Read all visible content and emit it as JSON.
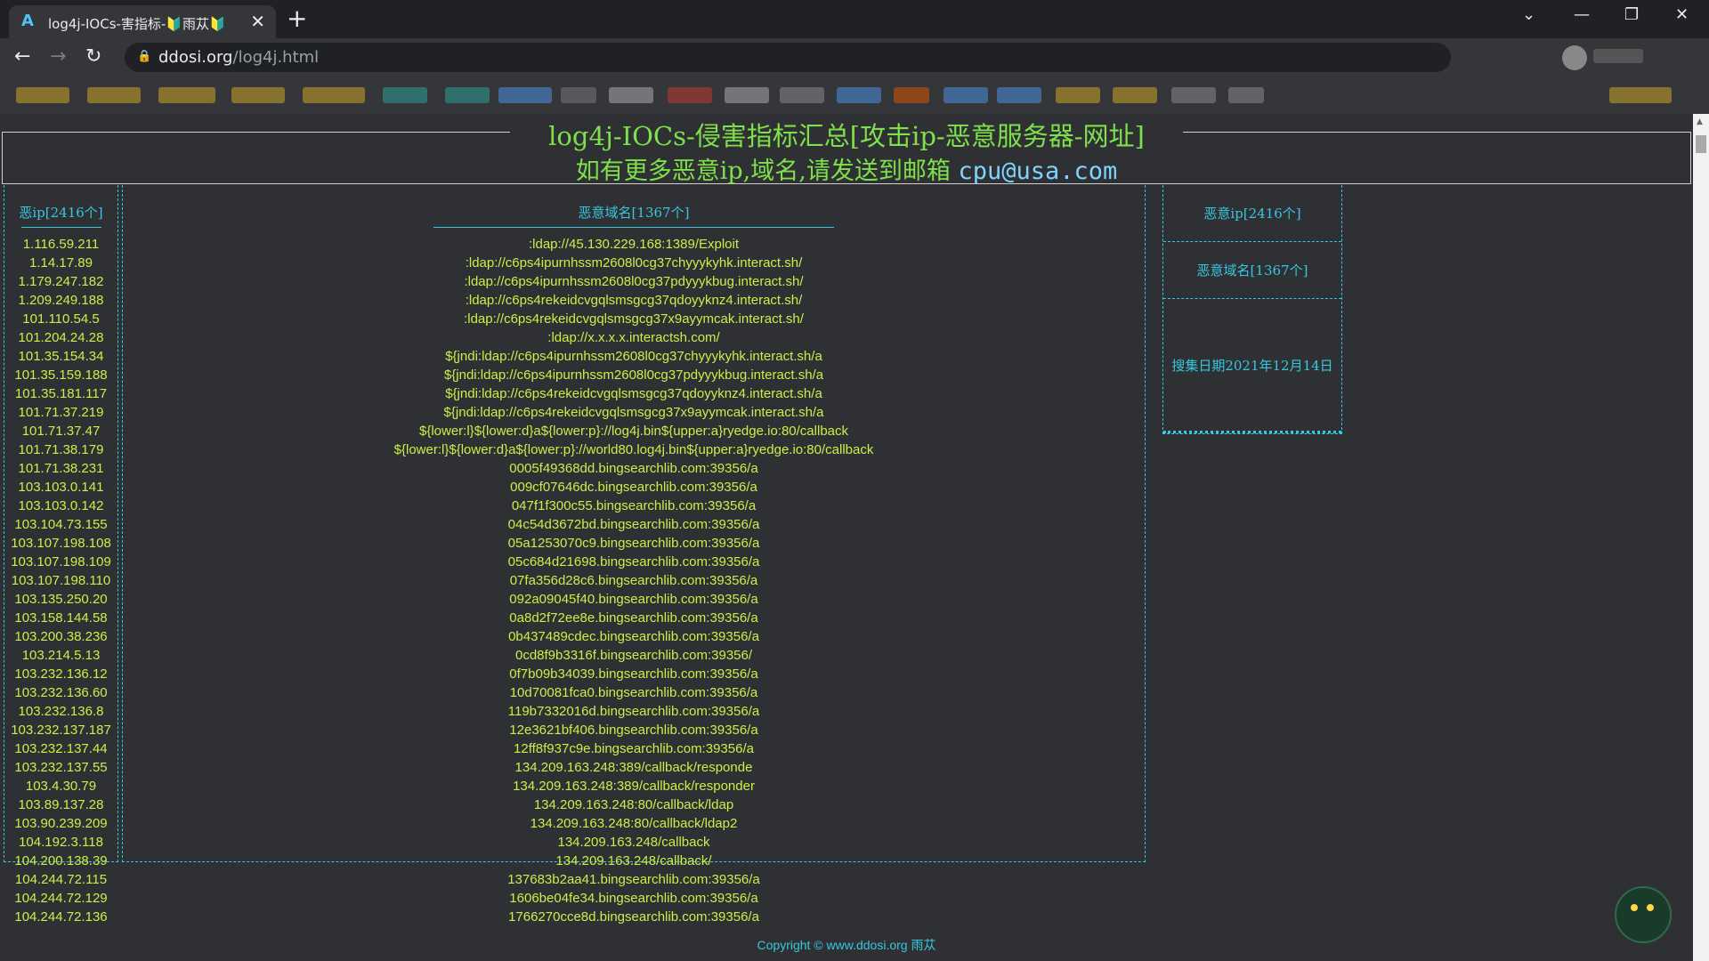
{
  "browser": {
    "tab_title": "log4j-IOCs-害指标-🔰雨苁🔰",
    "url_host": "ddosi.org",
    "url_path": "/log4j.html"
  },
  "header": {
    "title": "log4j-IOCs-侵害指标汇总[攻击ip-恶意服务器-网址]",
    "subtitle": "如有更多恶意ip,域名,请发送到邮箱",
    "email": "cpu@usa.com"
  },
  "left": {
    "title": "恶ip[2416个]",
    "ips": [
      "1.116.59.211",
      "1.14.17.89",
      "1.179.247.182",
      "1.209.249.188",
      "101.110.54.5",
      "101.204.24.28",
      "101.35.154.34",
      "101.35.159.188",
      "101.35.181.117",
      "101.71.37.219",
      "101.71.37.47",
      "101.71.38.179",
      "101.71.38.231",
      "103.103.0.141",
      "103.103.0.142",
      "103.104.73.155",
      "103.107.198.108",
      "103.107.198.109",
      "103.107.198.110",
      "103.135.250.20",
      "103.158.144.58",
      "103.200.38.236",
      "103.214.5.13",
      "103.232.136.12",
      "103.232.136.60",
      "103.232.136.8",
      "103.232.137.187",
      "103.232.137.44",
      "103.232.137.55",
      "103.4.30.79",
      "103.89.137.28",
      "103.90.239.209",
      "104.192.3.118",
      "104.200.138.39",
      "104.244.72.115",
      "104.244.72.129",
      "104.244.72.136"
    ]
  },
  "center": {
    "title": "恶意域名[1367个]",
    "domains": [
      ":ldap://45.130.229.168:1389/Exploit",
      ":ldap://c6ps4ipurnhssm2608l0cg37chyyykyhk.interact.sh/",
      ":ldap://c6ps4ipurnhssm2608l0cg37pdyyykbug.interact.sh/",
      ":ldap://c6ps4rekeidcvgqlsmsgcg37qdoyyknz4.interact.sh/",
      ":ldap://c6ps4rekeidcvgqlsmsgcg37x9ayymcak.interact.sh/",
      ":ldap://x.x.x.x.interactsh.com/",
      "${jndi:ldap://c6ps4ipurnhssm2608l0cg37chyyykyhk.interact.sh/a",
      "${jndi:ldap://c6ps4ipurnhssm2608l0cg37pdyyykbug.interact.sh/a",
      "${jndi:ldap://c6ps4rekeidcvgqlsmsgcg37qdoyyknz4.interact.sh/a",
      "${jndi:ldap://c6ps4rekeidcvgqlsmsgcg37x9ayymcak.interact.sh/a",
      "${lower:l}${lower:d}a${lower:p}://log4j.bin${upper:a}ryedge.io:80/callback",
      "${lower:l}${lower:d}a${lower:p}://world80.log4j.bin${upper:a}ryedge.io:80/callback",
      "0005f49368dd.bingsearchlib.com:39356/a",
      "009cf07646dc.bingsearchlib.com:39356/a",
      "047f1f300c55.bingsearchlib.com:39356/a",
      "04c54d3672bd.bingsearchlib.com:39356/a",
      "05a1253070c9.bingsearchlib.com:39356/a",
      "05c684d21698.bingsearchlib.com:39356/a",
      "07fa356d28c6.bingsearchlib.com:39356/a",
      "092a09045f40.bingsearchlib.com:39356/a",
      "0a8d2f72ee8e.bingsearchlib.com:39356/a",
      "0b437489cdec.bingsearchlib.com:39356/a",
      "0cd8f9b3316f.bingsearchlib.com:39356/",
      "0f7b09b34039.bingsearchlib.com:39356/a",
      "10d70081fca0.bingsearchlib.com:39356/a",
      "119b7332016d.bingsearchlib.com:39356/a",
      "12e3621bf406.bingsearchlib.com:39356/a",
      "12ff8f937c9e.bingsearchlib.com:39356/a",
      "134.209.163.248:389/callback/responde",
      "134.209.163.248:389/callback/responder",
      "134.209.163.248:80/callback/ldap",
      "134.209.163.248:80/callback/ldap2",
      "134.209.163.248/callback",
      "134.209.163.248/callback/",
      "137683b2aa41.bingsearchlib.com:39356/a",
      "1606be04fe34.bingsearchlib.com:39356/a",
      "1766270cce8d.bingsearchlib.com:39356/a"
    ]
  },
  "right": {
    "ip_label": "恶意ip[2416个]",
    "domain_label": "恶意域名[1367个]",
    "date_label": "搜集日期2021年12月14日"
  },
  "footer": {
    "text": "Copyright © www.ddosi.org 雨苁"
  }
}
